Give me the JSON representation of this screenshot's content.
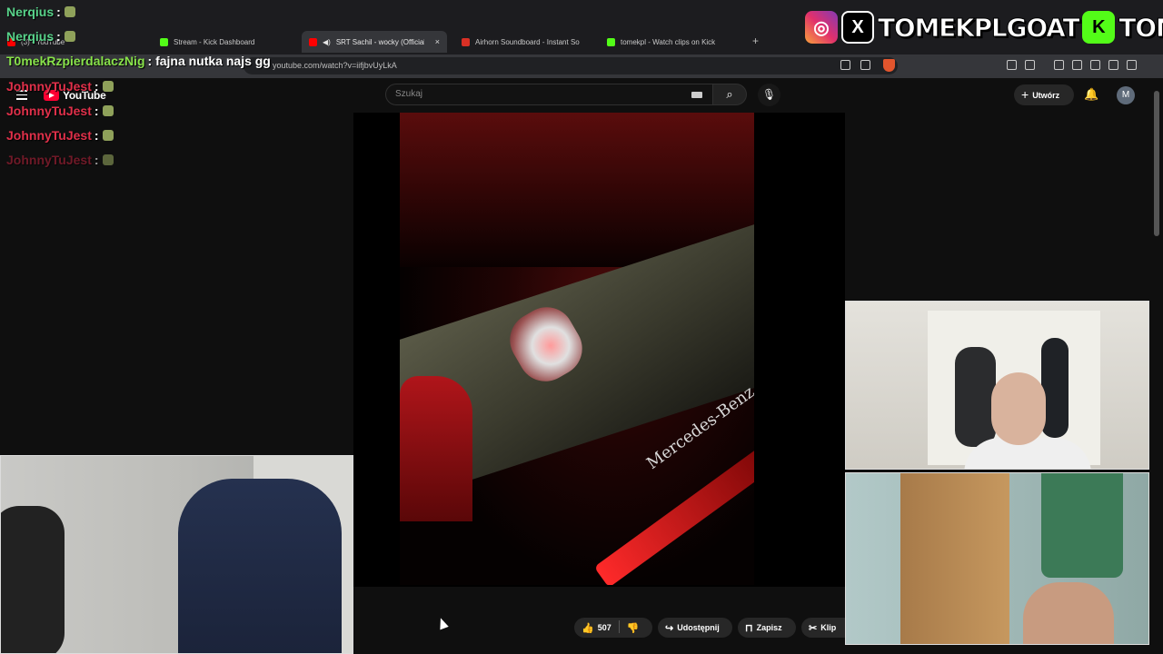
{
  "browser": {
    "tabs": [
      {
        "title": "(3) - YouTube",
        "color": "#ff0000"
      },
      {
        "title": "Stream - Kick Dashboard",
        "color": "#53fc18"
      },
      {
        "title": "SRT Sachil - wocky (Official A",
        "color": "#ff0000",
        "active": true
      },
      {
        "title": "Airhorn Soundboard - Instant So",
        "color": "#d93025"
      },
      {
        "title": "tomekpl - Watch clips on Kick",
        "color": "#53fc18"
      }
    ],
    "new_tab": "+",
    "url": "youtube.com/watch?v=iifjbvUyLkA",
    "close_glyph": "×"
  },
  "youtube": {
    "logo_text": "YouTube",
    "search_placeholder": "Szukaj",
    "create_label": "Utwórz",
    "avatar_letter": "M"
  },
  "video": {
    "overlay_text": "Mercedes-Benz",
    "actions": {
      "like_count": "507",
      "share_label": "Udostępnij",
      "save_label": "Zapisz",
      "clip_label": "Klip"
    }
  },
  "overlay": {
    "handles": [
      "TOMEKPLGOAT",
      "TOMEKPL"
    ],
    "brand_colors": {
      "instagram": "#e1306c",
      "kick": "#53fc18"
    }
  },
  "chat": [
    {
      "user": "Nerqius",
      "color": "#58d38a",
      "message": ""
    },
    {
      "user": "Nerqius",
      "color": "#58d38a",
      "message": ""
    },
    {
      "user": "T0mekRzpierdalaczNig",
      "color": "#88e24a",
      "message": "fajna nutka najs gg"
    },
    {
      "user": "JohnnyTuJest",
      "color": "#e0304a",
      "message": ""
    },
    {
      "user": "JohnnyTuJest",
      "color": "#e0304a",
      "message": ""
    },
    {
      "user": "JohnnyTuJest",
      "color": "#e0304a",
      "message": ""
    },
    {
      "user": "JohnnyTuJest",
      "color": "#b02038",
      "message": ""
    }
  ]
}
